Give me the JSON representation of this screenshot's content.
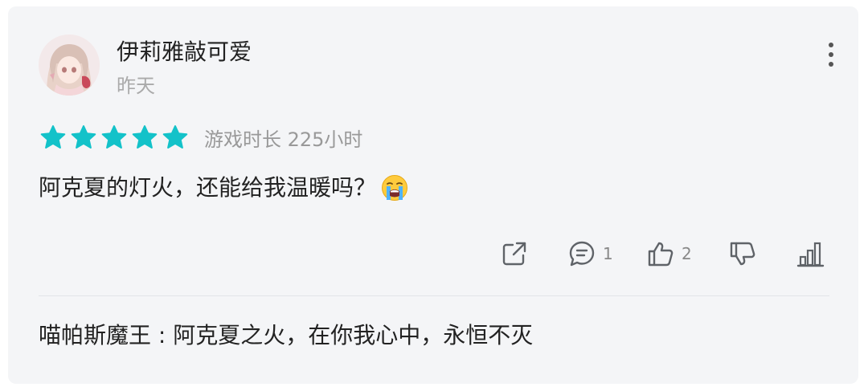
{
  "user": {
    "name": "伊莉雅敲可爱",
    "date": "昨天"
  },
  "rating": {
    "stars": 5,
    "max_stars": 5,
    "playtime": "游戏时长 225小时"
  },
  "review": {
    "text": "阿克夏的灯火，还能给我温暖吗？",
    "emoji_icon": "loudly-crying-face-icon"
  },
  "actions": {
    "comments_count": "1",
    "likes_count": "2"
  },
  "reply": {
    "author": "喵帕斯魔王",
    "separator": " : ",
    "text": "阿克夏之火，在你我心中，永恒不灭"
  },
  "colors": {
    "accent_star": "#13c2c9",
    "card_bg": "#f4f5f7",
    "text_primary": "#222222",
    "text_secondary": "#999999"
  }
}
